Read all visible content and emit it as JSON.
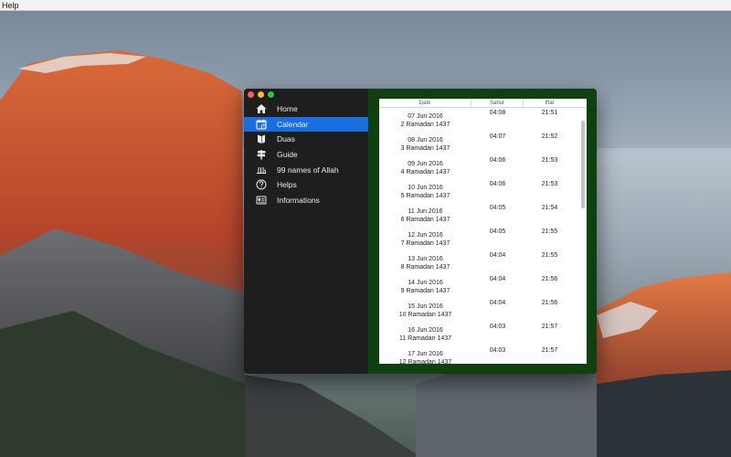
{
  "menubar": {
    "help_label": "Help"
  },
  "window": {
    "sidebar": {
      "items": [
        {
          "label": "Home",
          "icon": "home-icon",
          "active": false
        },
        {
          "label": "Calendar",
          "icon": "calendar-icon",
          "active": true
        },
        {
          "label": "Duas",
          "icon": "book-icon",
          "active": false
        },
        {
          "label": "Guide",
          "icon": "signpost-icon",
          "active": false
        },
        {
          "label": "99 names of Allah",
          "icon": "allah-calligraphy-icon",
          "active": false
        },
        {
          "label": "Helps",
          "icon": "question-icon",
          "active": false
        },
        {
          "label": "Informations",
          "icon": "info-card-icon",
          "active": false
        }
      ]
    },
    "table": {
      "headers": {
        "date": "Date",
        "sahur": "Sahur",
        "iftar": "Iftar"
      },
      "rows": [
        {
          "greg": "07 Jun 2016",
          "hijri": "2 Ramadan 1437",
          "sahur": "04:08",
          "iftar": "21:51"
        },
        {
          "greg": "08 Jun 2016",
          "hijri": "3 Ramadan 1437",
          "sahur": "04:07",
          "iftar": "21:52"
        },
        {
          "greg": "09 Jun 2016",
          "hijri": "4 Ramadan 1437",
          "sahur": "04:06",
          "iftar": "21:53"
        },
        {
          "greg": "10 Jun 2016",
          "hijri": "5 Ramadan 1437",
          "sahur": "04:06",
          "iftar": "21:53"
        },
        {
          "greg": "11 Jun 2016",
          "hijri": "6 Ramadan 1437",
          "sahur": "04:05",
          "iftar": "21:54"
        },
        {
          "greg": "12 Jun 2016",
          "hijri": "7 Ramadan 1437",
          "sahur": "04:05",
          "iftar": "21:55"
        },
        {
          "greg": "13 Jun 2016",
          "hijri": "8 Ramadan 1437",
          "sahur": "04:04",
          "iftar": "21:55"
        },
        {
          "greg": "14 Jun 2016",
          "hijri": "9 Ramadan 1437",
          "sahur": "04:04",
          "iftar": "21:56"
        },
        {
          "greg": "15 Jun 2016",
          "hijri": "10 Ramadan 1437",
          "sahur": "04:04",
          "iftar": "21:56"
        },
        {
          "greg": "16 Jun 2016",
          "hijri": "11 Ramadan 1437",
          "sahur": "04:03",
          "iftar": "21:57"
        },
        {
          "greg": "17 Jun 2016",
          "hijri": "12 Ramadan 1437",
          "sahur": "04:03",
          "iftar": "21:57"
        }
      ]
    }
  },
  "colors": {
    "sidebar_bg": "#1e1e1f",
    "active_item": "#1a6fe0",
    "content_bg": "#0f4110",
    "close": "#fc5f57",
    "minimize": "#fdbc2e",
    "zoom": "#29c840"
  }
}
